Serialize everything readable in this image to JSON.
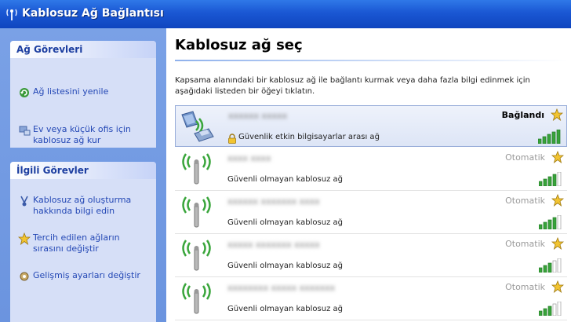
{
  "window": {
    "title": "Kablosuz Ağ Bağlantısı",
    "title_icon": "wireless-antenna-icon"
  },
  "sidebar": {
    "tasks_panel": {
      "title": "Ağ Görevleri",
      "items": [
        {
          "label": "Ağ listesini yenile",
          "icon": "refresh-icon"
        },
        {
          "label": "Ev veya küçük ofis için kablosuz ağ kur",
          "icon": "network-setup-icon"
        }
      ]
    },
    "related_panel": {
      "title": "İlgili Görevler",
      "items": [
        {
          "label": "Kablosuz ağ oluşturma hakkında bilgi edin",
          "icon": "info-icon"
        },
        {
          "label": "Tercih edilen ağların sırasını değiştir",
          "icon": "star-icon"
        },
        {
          "label": "Gelişmiş ayarları değiştir",
          "icon": "settings-icon"
        }
      ]
    }
  },
  "main": {
    "heading": "Kablosuz ağ seç",
    "description": "Kapsama alanındaki bir kablosuz ağ ile bağlantı kurmak veya daha fazla bilgi edinmek için aşağıdaki listeden bir öğeyi tıklatın.",
    "networks": [
      {
        "name": "xxxxxx xxxxx",
        "status": "Bağlandı",
        "security": "Güvenlik etkin bilgisayarlar arası ağ",
        "connected": true,
        "secured": true,
        "signal_level": 5,
        "signal_max": 5
      },
      {
        "name": "xxxx xxxx",
        "status": "Otomatik",
        "security": "Güvenli olmayan kablosuz ağ",
        "connected": false,
        "secured": false,
        "signal_level": 4,
        "signal_max": 5
      },
      {
        "name": "xxxxxx xxxxxxx xxxx",
        "status": "Otomatik",
        "security": "Güvenli olmayan kablosuz ağ",
        "connected": false,
        "secured": false,
        "signal_level": 4,
        "signal_max": 5
      },
      {
        "name": "xxxxx xxxxxxx xxxxx",
        "status": "Otomatik",
        "security": "Güvenli olmayan kablosuz ağ",
        "connected": false,
        "secured": false,
        "signal_level": 3,
        "signal_max": 5
      },
      {
        "name": "xxxxxxxx xxxxx xxxxxxx",
        "status": "Otomatik",
        "security": "Güvenli olmayan kablosuz ağ",
        "connected": false,
        "secured": false,
        "signal_level": 3,
        "signal_max": 5
      }
    ]
  },
  "colors": {
    "title_bar": "#1a57d3",
    "sidebar_bg": "#6b94df",
    "link": "#2448b5",
    "signal_on": "#38a33a",
    "signal_off": "#c8c8c8"
  }
}
